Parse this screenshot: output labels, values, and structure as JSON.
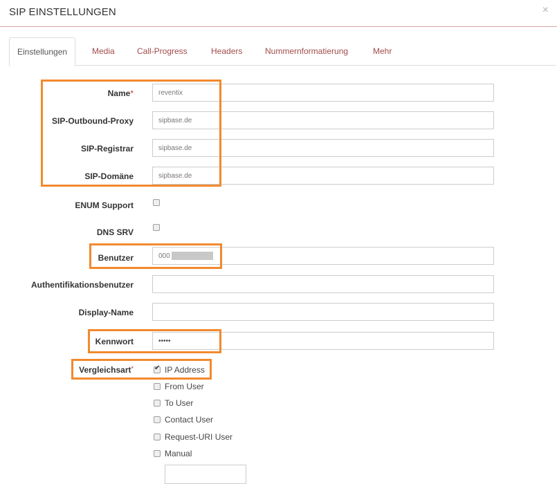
{
  "header": {
    "title": "SIP EINSTELLUNGEN",
    "close_glyph": "×"
  },
  "tabs": [
    {
      "label": "Einstellungen",
      "active": true
    },
    {
      "label": "Media"
    },
    {
      "label": "Call-Progress"
    },
    {
      "label": "Headers"
    },
    {
      "label": "Nummernformatierung"
    },
    {
      "label": "Mehr"
    }
  ],
  "form": {
    "name": {
      "label": "Name",
      "required_mark": "*",
      "value": "reventix"
    },
    "outbound_proxy": {
      "label": "SIP-Outbound-Proxy",
      "value": "sipbase.de"
    },
    "registrar": {
      "label": "SIP-Registrar",
      "value": "sipbase.de"
    },
    "domain": {
      "label": "SIP-Domäne",
      "value": "sipbase.de"
    },
    "enum_support": {
      "label": "ENUM Support",
      "checked": false
    },
    "dns_srv": {
      "label": "DNS SRV",
      "checked": false
    },
    "benutzer": {
      "label": "Benutzer",
      "value": "000"
    },
    "auth_user": {
      "label": "Authentifikationsbenutzer",
      "value": ""
    },
    "display_name": {
      "label": "Display-Name",
      "value": ""
    },
    "kennwort": {
      "label": "Kennwort",
      "value": "•••••"
    },
    "vergleichsart": {
      "label": "Vergleichsart",
      "required_mark": "*",
      "options": [
        {
          "label": "IP Address",
          "checked": true
        },
        {
          "label": "From User",
          "checked": false
        },
        {
          "label": "To User",
          "checked": false
        },
        {
          "label": "Contact User",
          "checked": false
        },
        {
          "label": "Request-URI User",
          "checked": false
        },
        {
          "label": "Manual",
          "checked": false
        }
      ],
      "manual_value": ""
    }
  },
  "colors": {
    "highlight": "#f2892e",
    "tab_link": "#a24b4b",
    "required": "#c0392b"
  }
}
